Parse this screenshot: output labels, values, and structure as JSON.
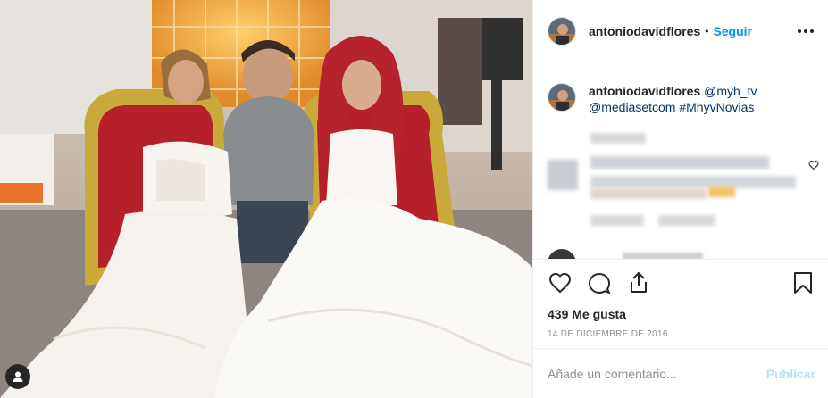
{
  "post": {
    "username": "antoniodavidflores",
    "separator": "•",
    "follow_label": "Seguir",
    "more_icon": "more-options-icon"
  },
  "caption": {
    "username": "antoniodavidflores",
    "mention_1": "@myh_tv",
    "mention_2": "@mediasetcom",
    "hashtag": "#MhyvNovias"
  },
  "actions": {
    "like_icon": "heart-icon",
    "comment_icon": "comment-icon",
    "share_icon": "share-icon",
    "save_icon": "bookmark-icon"
  },
  "likes_label": "439 Me gusta",
  "date_label": "14 DE DICIEMBRE DE 2016",
  "comment_box": {
    "placeholder": "Añade un comentario...",
    "publish_label": "Publicar"
  },
  "colors": {
    "link": "#0095f6",
    "publish_disabled": "#b2dffc",
    "text": "#262626",
    "muted": "#8e8e8e"
  }
}
